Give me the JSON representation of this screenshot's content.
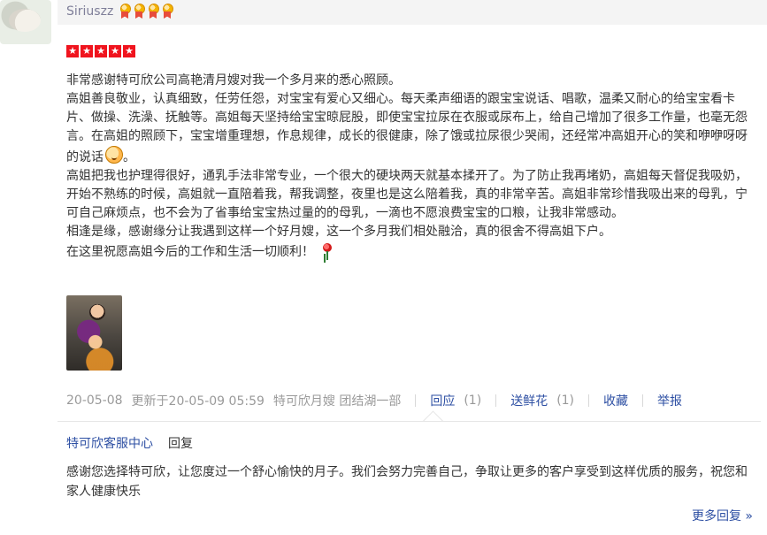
{
  "user": {
    "name": "Siriuszz",
    "medal_count": 4
  },
  "rating": {
    "stars": 5
  },
  "review": {
    "paragraphs": [
      "非常感谢特可欣公司高艳清月嫂对我一个多月来的悉心照顾。",
      "高姐善良敬业，认真细致，任劳任怨，对宝宝有爱心又细心。每天柔声细语的跟宝宝说话、唱歌，温柔又耐心的给宝宝看卡片、做操、洗澡、抚触等。高姐每天坚持给宝宝晾屁股，即使宝宝拉尿在衣服或尿布上，给自己增加了很多工作量，也毫无怨言。在高姐的照顾下，宝宝增重理想，作息规律，成长的很健康，除了饿或拉尿很少哭闹，还经常冲高姐开心的笑和咿咿呀呀的说话",
      "高姐把我也护理得很好，通乳手法非常专业，一个很大的硬块两天就基本揉开了。为了防止我再堵奶，高姐每天督促我吸奶，开始不熟练的时候，高姐就一直陪着我，帮我调整，夜里也是这么陪着我，真的非常辛苦。高姐非常珍惜我吸出来的母乳，宁可自己麻烦点，也不会为了省事给宝宝热过量的的母乳，一滴也不愿浪费宝宝的口粮，让我非常感动。",
      "相逢是缘，感谢缘分让我遇到这样一个好月嫂，这一个多月我们相处融洽，真的很舍不得高姐下户。",
      "在这里祝愿高姐今后的工作和生活一切顺利！"
    ]
  },
  "meta": {
    "date": "20-05-08",
    "updated": "更新于20-05-09 05:59",
    "source": "特可欣月嫂 团结湖一部",
    "reply_label": "回应",
    "reply_count": "(1)",
    "flower_label": "送鲜花",
    "flower_count": "(1)",
    "collect_label": "收藏",
    "report_label": "举报"
  },
  "reply": {
    "author": "特可欣客服中心",
    "label": "回复",
    "text": "感谢您选择特可欣，让您度过一个舒心愉快的月子。我们会努力完善自己，争取让更多的客户享受到这样优质的服务，祝您和家人健康快乐",
    "more_label": "更多回复 »"
  },
  "icons": {
    "medal": "medal-icon",
    "star": "star-icon",
    "smile": "smile-emoji-icon",
    "rose": "rose-emoji-icon"
  },
  "colors": {
    "link": "#2d4fa3",
    "header_bg": "#f4f4f4",
    "star_bg": "#f0141e"
  }
}
